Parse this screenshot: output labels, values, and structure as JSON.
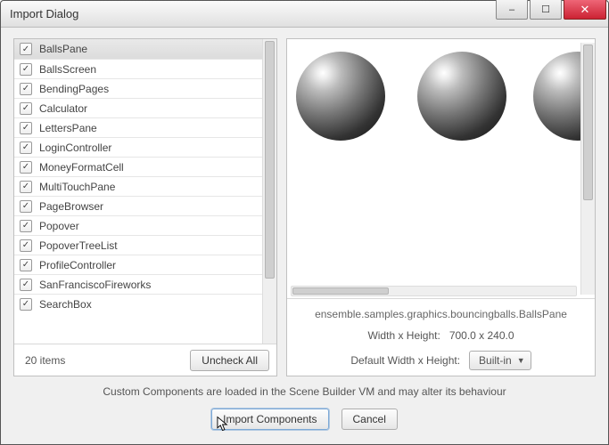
{
  "window": {
    "title": "Import Dialog"
  },
  "list": {
    "items": [
      "BallsPane",
      "BallsScreen",
      "BendingPages",
      "Calculator",
      "LettersPane",
      "LoginController",
      "MoneyFormatCell",
      "MultiTouchPane",
      "PageBrowser",
      "Popover",
      "PopoverTreeList",
      "ProfileController",
      "SanFranciscoFireworks",
      "SearchBox"
    ],
    "selectedIndex": 0,
    "countText": "20 items",
    "uncheckAll": "Uncheck All"
  },
  "preview": {
    "classPath": "ensemble.samples.graphics.bouncingballs.BallsPane",
    "sizeLabel": "Width x Height:",
    "sizeValue": "700.0 x 240.0",
    "defaultSizeLabel": "Default Width x Height:",
    "defaultSizeValue": "Built-in"
  },
  "footer": {
    "note": "Custom Components are loaded in the Scene Builder VM and may alter its behaviour",
    "importBtn": "Import Components",
    "cancelBtn": "Cancel"
  }
}
